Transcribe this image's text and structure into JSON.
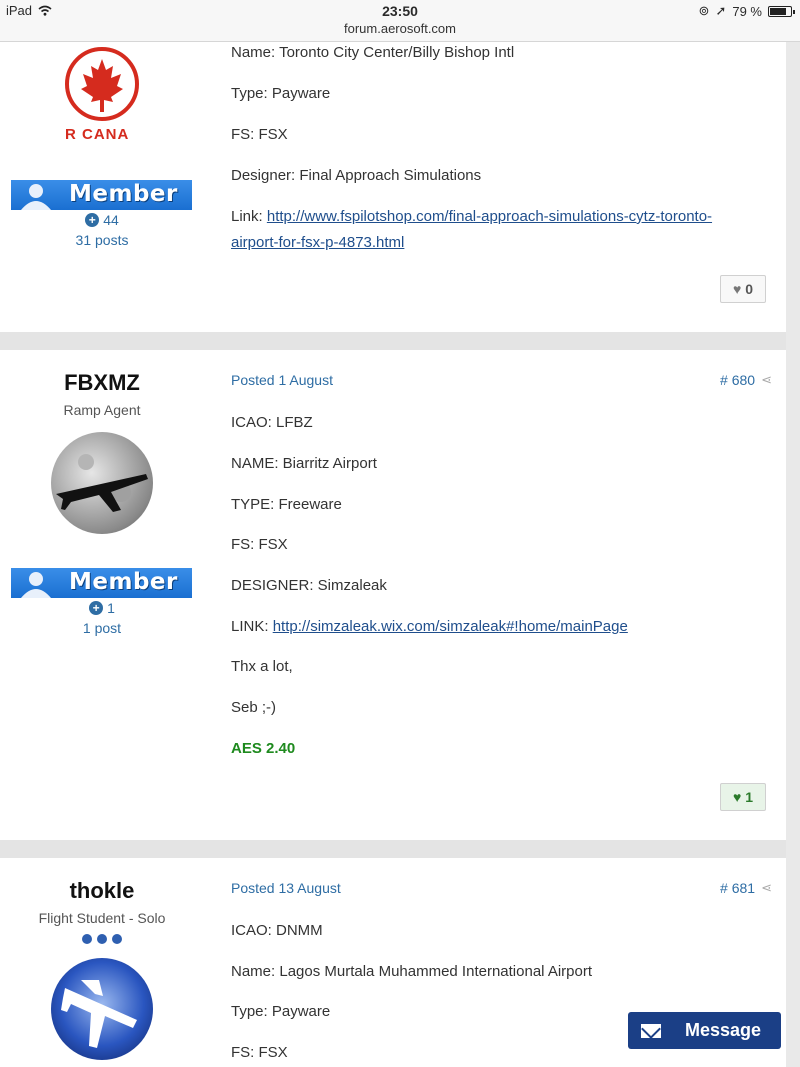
{
  "status_bar": {
    "device": "iPad",
    "time": "23:50",
    "url": "forum.aerosoft.com",
    "battery": "79 %",
    "battery_level": 0.79
  },
  "posts": [
    {
      "author": {
        "logo_text": "R CANA",
        "badge": "Member",
        "reputation": "44",
        "post_count": "31 posts"
      },
      "lines": [
        "Name: Toronto City Center/Billy Bishop Intl",
        "Type: Payware",
        "FS: FSX",
        "Designer: Final Approach Simulations"
      ],
      "link_label": "Link: ",
      "link_line1": "http://www.fspilotshop.com/final-approach-simulations-cytz-toronto-",
      "link_line2": "airport-for-fsx-p-4873.html",
      "reaction_count": "0"
    },
    {
      "author": {
        "name": "FBXMZ",
        "rank": "Ramp Agent",
        "badge": "Member",
        "reputation": "1",
        "post_count": "1 post"
      },
      "posted": "Posted 1 August",
      "number": "# 680",
      "lines": [
        "ICAO: LFBZ",
        "NAME: Biarritz Airport",
        "TYPE: Freeware",
        "FS: FSX",
        "DESIGNER: Simzaleak"
      ],
      "link_label": "LINK: ",
      "link": "http://simzaleak.wix.com/simzaleak#!home/mainPage",
      "extra": [
        "Thx a lot,",
        "Seb ;-)"
      ],
      "signature": "AES 2.40",
      "reaction_count": "1"
    },
    {
      "author": {
        "name": "thokle",
        "rank": "Flight Student - Solo"
      },
      "posted": "Posted 13 August",
      "number": "# 681",
      "lines": [
        "ICAO: DNMM",
        "Name: Lagos Murtala Muhammed International Airport",
        "Type: Payware",
        "FS: FSX"
      ]
    }
  ],
  "message_button": "Message"
}
